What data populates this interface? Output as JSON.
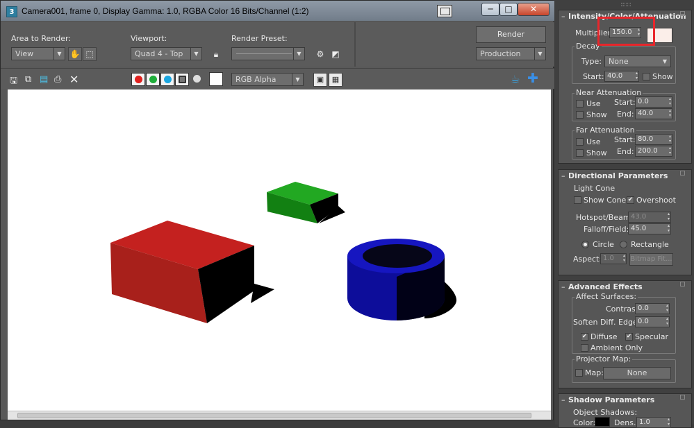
{
  "window": {
    "title": "Camera001, frame 0, Display Gamma: 1.0, RGBA Color 16 Bits/Channel (1:2)",
    "app_icon": "3",
    "minimize": "─",
    "maximize": "□",
    "close": "✕"
  },
  "toolbar": {
    "area_label": "Area to Render:",
    "area_value": "View",
    "viewport_label": "Viewport:",
    "viewport_value": "Quad 4 - Top",
    "preset_label": "Render Preset:",
    "preset_value": "",
    "render_button": "Render",
    "mode_value": "Production"
  },
  "display_toolbar": {
    "channel_value": "RGB Alpha",
    "icons": [
      "save-icon",
      "copy-icon",
      "clone-icon",
      "print-icon",
      "clear-icon",
      "red-channel-icon",
      "green-channel-icon",
      "blue-channel-icon",
      "alpha-channel-icon",
      "mono-icon",
      "color-swatch-icon",
      "teapot-icon",
      "crosshair-icon"
    ]
  },
  "colors": {
    "red_box": "#c4211f",
    "green_box": "#1a9a1a",
    "blue_tube": "#1010a8",
    "highlight": "#e8262b"
  },
  "panel": {
    "intensity": {
      "title": "Intensity/Color/Attenuation",
      "multiplier_label": "Multiplier:",
      "multiplier_value": "150.0",
      "decay_label": "Decay",
      "type_label": "Type:",
      "type_value": "None",
      "start_label": "Start:",
      "start_value": "40.0",
      "show_label": "Show",
      "near_label": "Near Attenuation",
      "near_use": "Use",
      "near_show": "Show",
      "near_start_label": "Start:",
      "near_start_value": "0.0",
      "near_end_label": "End:",
      "near_end_value": "40.0",
      "far_label": "Far Attenuation",
      "far_use": "Use",
      "far_show": "Show",
      "far_start_label": "Start:",
      "far_start_value": "80.0",
      "far_end_label": "End:",
      "far_end_value": "200.0"
    },
    "directional": {
      "title": "Directional Parameters",
      "cone_label": "Light Cone",
      "show_cone": "Show Cone",
      "overshoot": "Overshoot",
      "hotspot_label": "Hotspot/Beam:",
      "hotspot_value": "43.0",
      "falloff_label": "Falloff/Field:",
      "falloff_value": "45.0",
      "circle": "Circle",
      "rectangle": "Rectangle",
      "aspect_label": "Aspect:",
      "aspect_value": "1.0",
      "bitmap_fit": "Bitmap Fit..."
    },
    "advanced": {
      "title": "Advanced Effects",
      "affect_label": "Affect Surfaces:",
      "contrast_label": "Contrast:",
      "contrast_value": "0.0",
      "soften_label": "Soften Diff. Edge:",
      "soften_value": "0.0",
      "diffuse": "Diffuse",
      "specular": "Specular",
      "ambient_only": "Ambient Only",
      "projector_label": "Projector Map:",
      "map_label": "Map:",
      "map_value": "None"
    },
    "shadow": {
      "title": "Shadow Parameters",
      "object_shadows": "Object Shadows:",
      "color_label": "Color:",
      "dens_label": "Dens.",
      "dens_value": "1.0"
    }
  }
}
